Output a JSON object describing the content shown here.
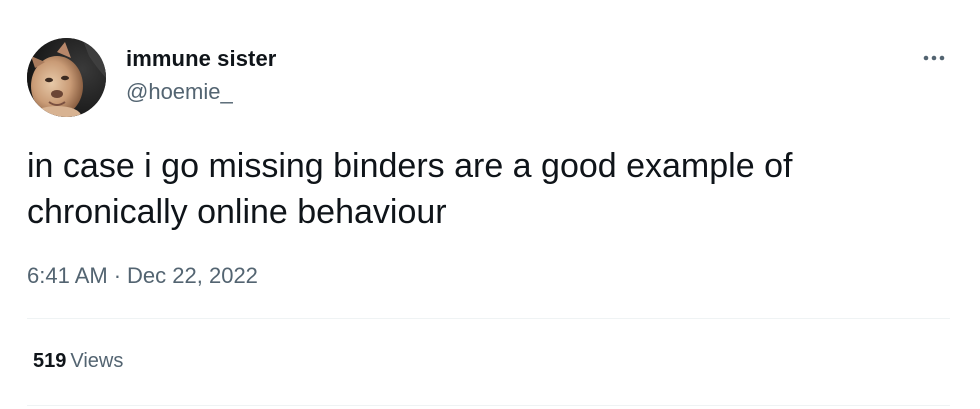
{
  "author": {
    "display_name": "immune sister",
    "handle": "@hoemie_",
    "avatar_icon": "dog-photo-avatar"
  },
  "more_icon": "more-options-icon",
  "tweet": {
    "text": "in case i go missing binders are a good example of chronically online behaviour",
    "time": "6:41 AM",
    "separator": "·",
    "date": "Dec 22, 2022"
  },
  "stats": {
    "views_count": "519",
    "views_label": "Views"
  },
  "colors": {
    "primary_text": "#0f1419",
    "secondary_text": "#536471",
    "divider": "#eff3f4"
  }
}
